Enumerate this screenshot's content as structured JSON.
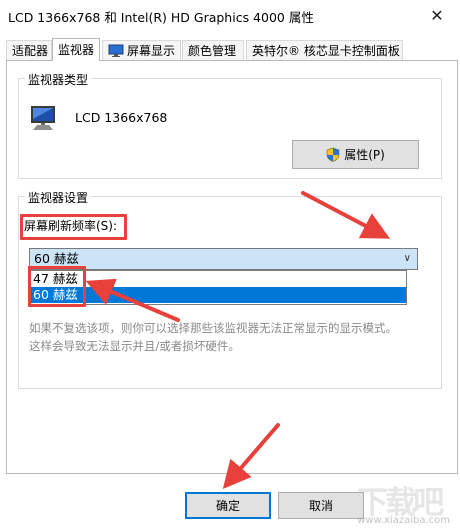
{
  "window": {
    "title": "LCD 1366x768 和 Intel(R) HD Graphics 4000 属性",
    "close_glyph": "✕"
  },
  "tabs": [
    {
      "label": "适配器"
    },
    {
      "label": "监视器"
    },
    {
      "label": "屏幕显示"
    },
    {
      "label": "颜色管理"
    },
    {
      "label": "英特尔® 核芯显卡控制面板"
    }
  ],
  "monitor_type": {
    "legend": "监视器类型",
    "name": "LCD 1366x768",
    "properties_button": "属性(P)"
  },
  "monitor_settings": {
    "legend": "监视器设置",
    "refresh_label": "屏幕刷新频率(S):",
    "selected": "60 赫兹",
    "options": [
      "47 赫兹",
      "60 赫兹"
    ],
    "highlighted_option": "60 赫兹",
    "hint_lines": [
      "如果不复选该项，则你可以选择那些该监视器无法正常显示的显示模式。",
      "这样会导致无法显示并且/或者损坏硬件。"
    ]
  },
  "footer": {
    "ok": "确定",
    "cancel": "取消"
  },
  "watermark": {
    "logo": "下载吧",
    "url": "www.xiazaiba.com"
  },
  "colors": {
    "accent": "#0078d7",
    "highlight_selection": "#cce4f7",
    "annotation_red": "#e8403a"
  },
  "icons": {
    "monitor": "monitor-icon",
    "shield": "uac-shield-icon",
    "display_tab": "display-icon"
  }
}
